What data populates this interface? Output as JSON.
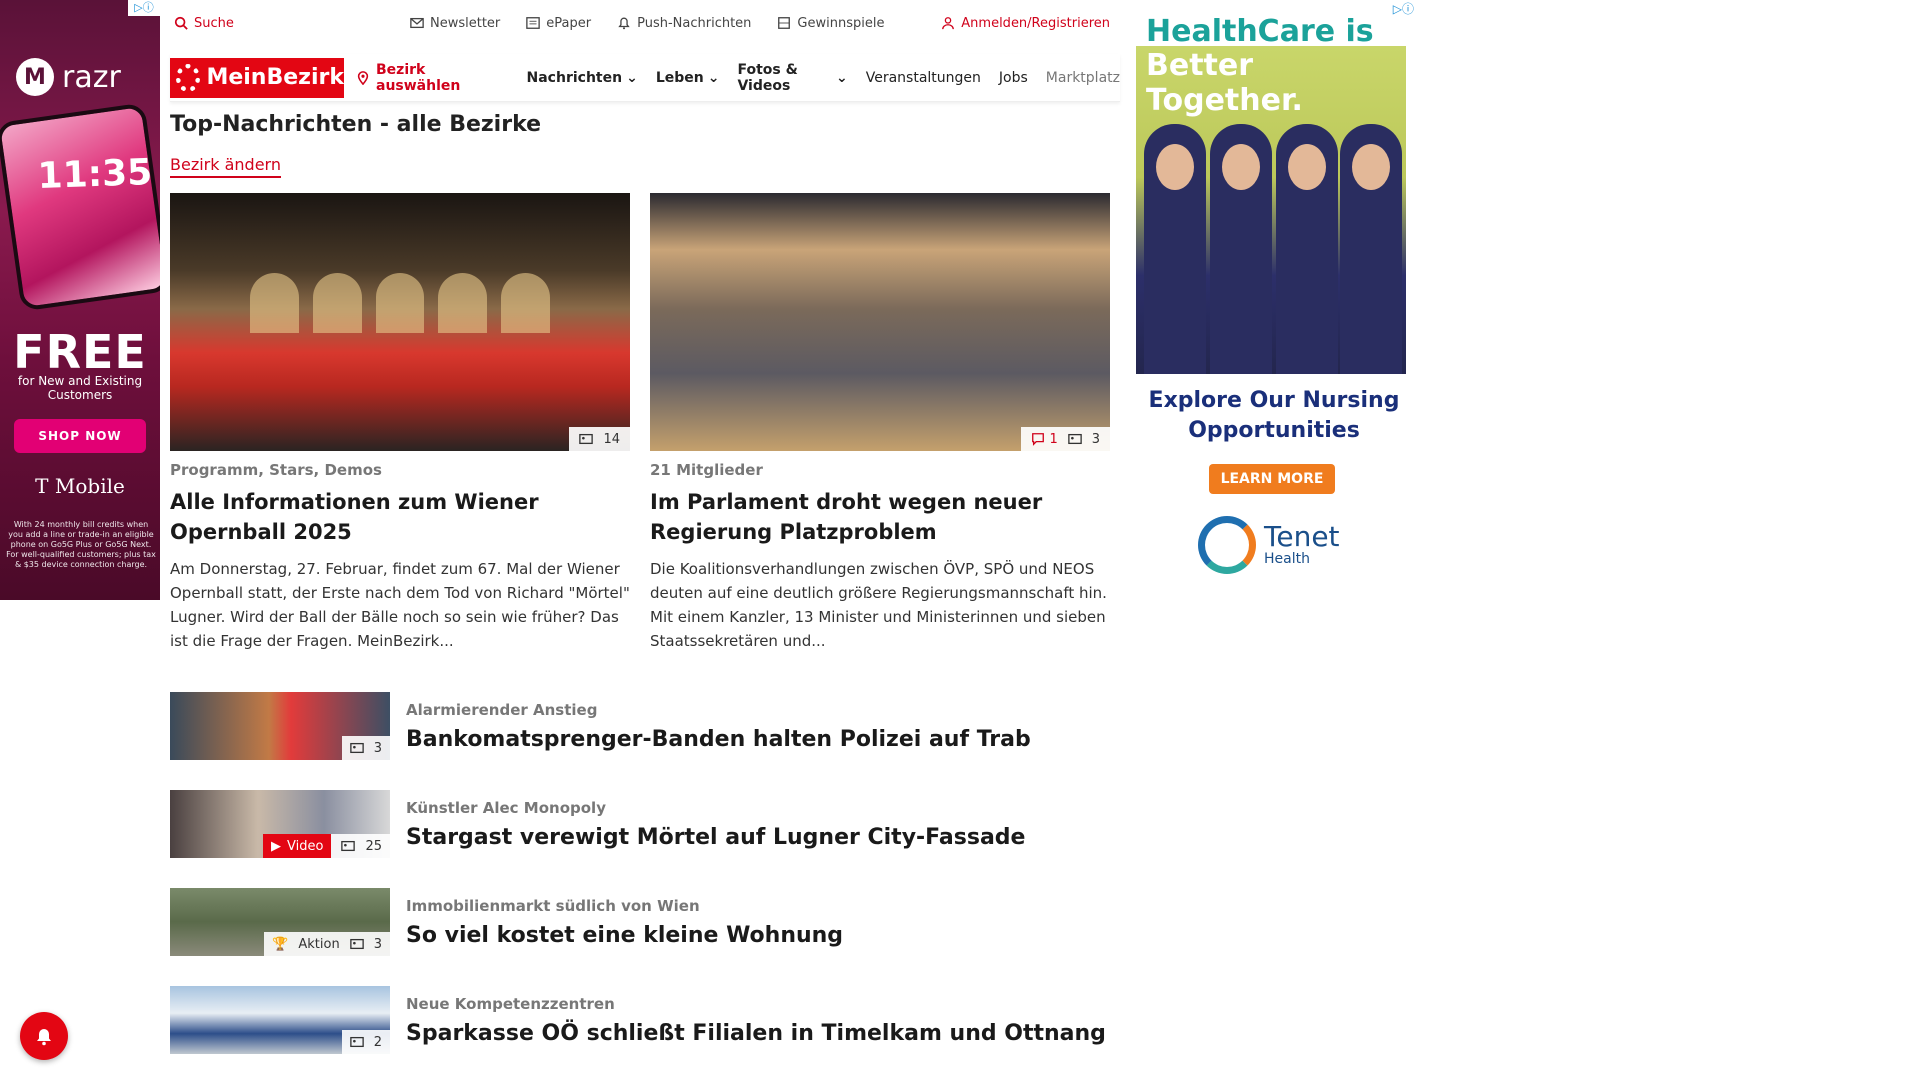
{
  "ad_left": {
    "brand": "razr",
    "time": "11:35",
    "free": "FREE",
    "free_sub": "for New and Existing Customers",
    "cta": "SHOP NOW",
    "advertiser": "T Mobile",
    "fine_print": "With 24 monthly bill credits when you add a line or trade-in an eligible phone on Go5G Plus or Go5G Next. For well-qualified customers; plus tax & $35 device connection charge."
  },
  "utility": {
    "search": "Suche",
    "newsletter": "Newsletter",
    "epaper": "ePaper",
    "push": "Push-Nachrichten",
    "gewinnspiele": "Gewinnspiele",
    "login": "Anmelden/Registrieren"
  },
  "nav": {
    "logo": "MeinBezirk",
    "bezirk": "Bezirk auswählen",
    "links": [
      "Nachrichten",
      "Leben",
      "Fotos & Videos",
      "Veranstaltungen",
      "Jobs",
      "Marktplatz"
    ]
  },
  "page": {
    "title": "Top-Nachrichten - alle Bezirke",
    "change_link": "Bezirk ändern"
  },
  "top_stories": [
    {
      "kicker": "Programm, Stars, Demos",
      "headline": "Alle Informationen zum Wiener Opernball 2025",
      "teaser": "Am Donnerstag, 27. Februar, findet zum 67. Mal der Wiener Opernball statt, der Erste nach dem Tod von Richard \"Mörtel\" Lugner. Wird der Ball der Bälle noch so sein wie früher? Das ist die Frage der Fragen. MeinBezirk...",
      "photos": "14"
    },
    {
      "kicker": "21 Mitglieder",
      "headline": "Im Parlament droht wegen neuer Regierung Platzproblem",
      "teaser": "Die Koalitionsverhandlungen zwischen ÖVP, SPÖ und NEOS deuten auf eine deutlich größere Regierungsmannschaft hin. Mit einem Kanzler, 13 Minister und Ministerinnen und sieben Staatssekretären und...",
      "comments": "1",
      "photos": "3"
    }
  ],
  "list": [
    {
      "kicker": "Alarmierender Anstieg",
      "headline": "Bankomatsprenger-Banden halten Polizei auf Trab",
      "photos": "3"
    },
    {
      "kicker": "Künstler Alec Monopoly",
      "headline": "Stargast verewigt Mörtel auf Lugner City-Fassade",
      "video": "Video",
      "photos": "25"
    },
    {
      "kicker": "Immobilienmarkt südlich von Wien",
      "headline": "So viel kostet eine kleine Wohnung",
      "aktion": "Aktion",
      "photos": "3"
    },
    {
      "kicker": "Neue Kompetenzzentren",
      "headline": "Sparkasse OÖ schließt Filialen in Timelkam und Ottnang",
      "photos": "2"
    }
  ],
  "ad_right": {
    "headline1": "HealthCare is",
    "headline2": "Better Together.",
    "explore": "Explore Our Nursing Opportunities",
    "cta": "LEARN MORE",
    "brand": "Tenet",
    "brand_sub": "Health"
  },
  "colors": {
    "accent": "#e30613",
    "link_red": "#d0021b"
  }
}
